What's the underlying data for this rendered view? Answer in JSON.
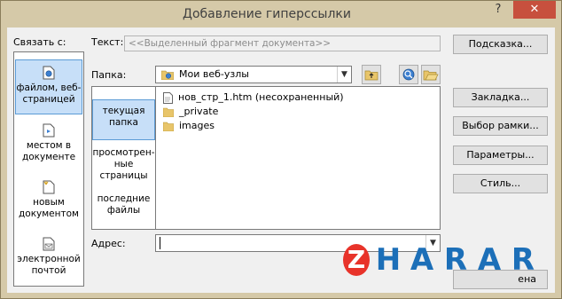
{
  "window": {
    "title": "Добавление гиперссылки",
    "help_glyph": "?",
    "close_glyph": "✕"
  },
  "link_with": {
    "label": "Связать с:",
    "items": [
      {
        "label": "файлом, веб-страницей",
        "icon": "web-page-icon",
        "selected": true
      },
      {
        "label": "местом в документе",
        "icon": "document-place-icon",
        "selected": false
      },
      {
        "label": "новым документом",
        "icon": "new-document-icon",
        "selected": false
      },
      {
        "label": "электронной почтой",
        "icon": "email-icon",
        "selected": false
      }
    ]
  },
  "text_field": {
    "label": "Текст:",
    "value": "<<Выделенный фрагмент документа>>"
  },
  "folder": {
    "label": "Папка:",
    "value": "Мои веб-узлы"
  },
  "places": [
    {
      "label": "текущая папка",
      "selected": true
    },
    {
      "label": "просмотрен-ные страницы",
      "selected": false
    },
    {
      "label": "последние файлы",
      "selected": false
    }
  ],
  "files": [
    {
      "name": "нов_стр_1.htm (несохраненный)",
      "icon": "html-file-icon"
    },
    {
      "name": "_private",
      "icon": "folder-icon"
    },
    {
      "name": "images",
      "icon": "folder-icon"
    }
  ],
  "address": {
    "label": "Адрес:",
    "value": ""
  },
  "buttons": {
    "hint": "Подсказка...",
    "bookmark": "Закладка...",
    "frame": "Выбор рамки...",
    "params": "Параметры...",
    "style": "Стиль...",
    "ok_partial": "ена"
  },
  "watermark": {
    "letters": [
      "Z",
      "H",
      "A",
      "R",
      "A",
      "R"
    ]
  },
  "colors": {
    "title_bg": "#d5c9a8",
    "close_red": "#c7503e",
    "selection": "#c7dff8",
    "watermark_red": "#e8332a",
    "watermark_blue": "#1c6fb8"
  }
}
